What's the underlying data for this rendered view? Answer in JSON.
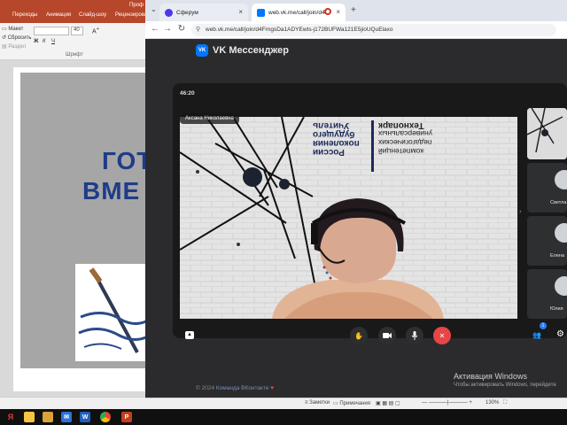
{
  "powerpoint": {
    "title_fragment": "Проф",
    "tabs": [
      "Переходы",
      "Анимация",
      "Слайд-шоу",
      "Рецензирова"
    ],
    "ribbon": {
      "layout_label": "Макет",
      "reset_label": "Сбросить",
      "section_label": "Раздел",
      "font_size": "40",
      "font_group_label": "Шрифт"
    },
    "slide": {
      "title_line1": "ГОТ",
      "title_line2": "ВМЕ"
    },
    "status": {
      "notes_label": "Заметки",
      "comments_label": "Примечания",
      "zoom": "130%"
    }
  },
  "browser": {
    "tabs": [
      {
        "label": "Сферум",
        "close": "×"
      },
      {
        "label": "web.vk.me/call/join/d4f",
        "close": "×"
      }
    ],
    "new_tab": "+",
    "url": "web.vk.me/call/join/d4FrngsDa1ADYEwts-j172BUFWa121E5jioUQuElaxo"
  },
  "vk": {
    "logo_mark": "VK",
    "brand_name": "VK Мессенджер",
    "call": {
      "timer": "46:20",
      "speaker_name": "Аксана Николаевна",
      "wall_text_left": [
        "Учитель",
        "будущего",
        "поколения",
        "России"
      ],
      "wall_text_right": [
        "Технопарк",
        "универсальных",
        "педагогических",
        "компетенций"
      ],
      "participants": [
        {
          "name": "Светла"
        },
        {
          "name": "Елена"
        },
        {
          "name": "Юлия"
        }
      ],
      "participants_badge": "1"
    },
    "footer": {
      "copyright": "© 2024",
      "team_link": "Команда ВКонтакте"
    }
  },
  "windows_activation": {
    "title": "Активация Windows",
    "subtitle": "Чтобы активировать Windows, перейдите"
  },
  "colors": {
    "ppt_accent": "#b7472a",
    "vk_blue": "#0077ff",
    "end_call_red": "#e64646",
    "call_bg": "#19191a",
    "slide_title": "#1f3c88"
  }
}
